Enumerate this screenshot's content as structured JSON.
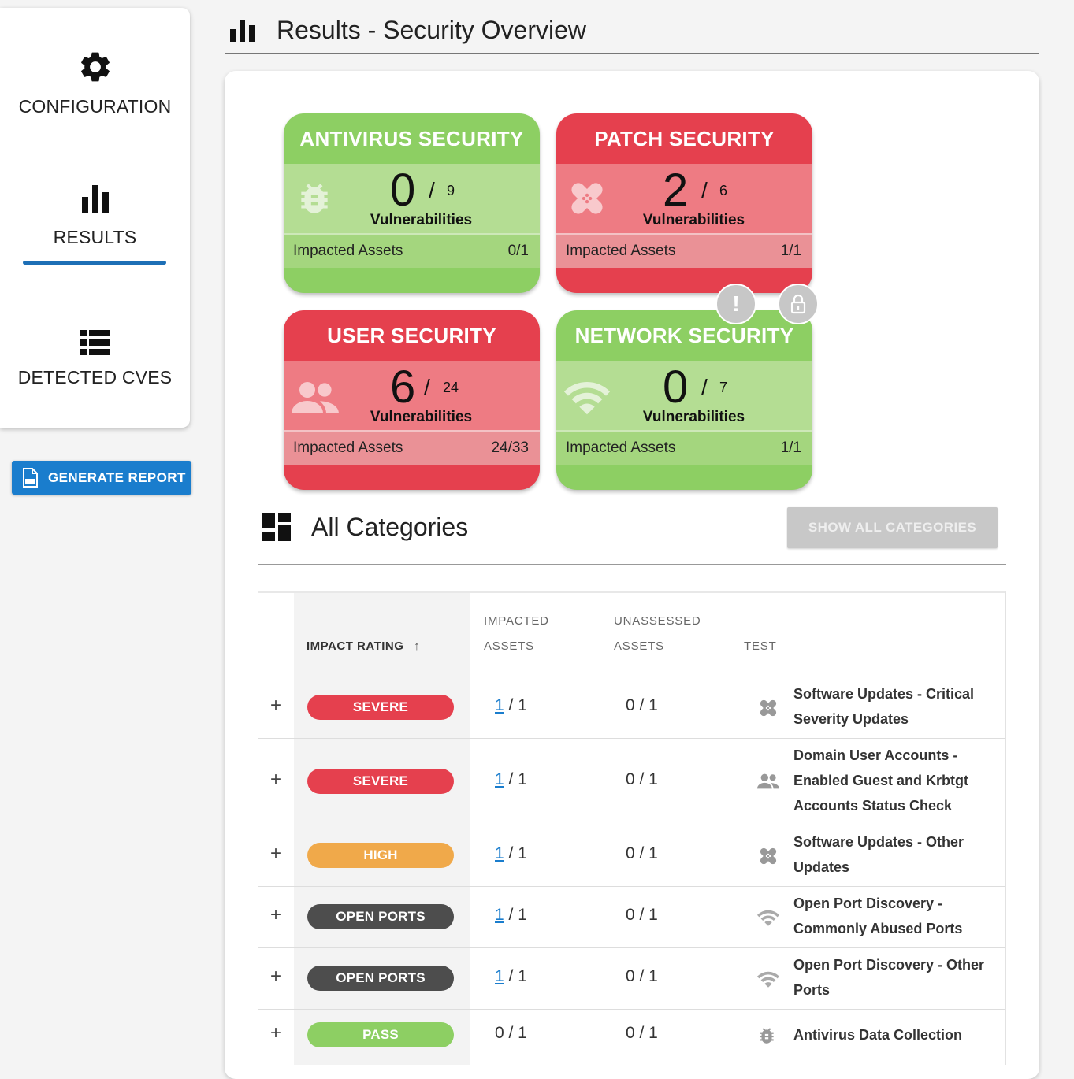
{
  "nav": {
    "configuration": "CONFIGURATION",
    "results": "RESULTS",
    "detected_cves": "DETECTED CVES"
  },
  "generate_report": "GENERATE REPORT",
  "header": {
    "title": "Results - Security Overview"
  },
  "tiles": [
    {
      "title": "ANTIVIRUS SECURITY",
      "status": "green",
      "count": "0",
      "slash": "/",
      "total": "9",
      "vuln_label": "Vulnerabilities",
      "assets_label": "Impacted Assets",
      "assets_value": "0/1",
      "icon": "bug-icon"
    },
    {
      "title": "PATCH SECURITY",
      "status": "red",
      "count": "2",
      "slash": "/",
      "total": "6",
      "vuln_label": "Vulnerabilities",
      "assets_label": "Impacted Assets",
      "assets_value": "1/1",
      "icon": "bandage-icon"
    },
    {
      "title": "USER SECURITY",
      "status": "red",
      "count": "6",
      "slash": "/",
      "total": "24",
      "vuln_label": "Vulnerabilities",
      "assets_label": "Impacted Assets",
      "assets_value": "24/33",
      "icon": "users-icon"
    },
    {
      "title": "NETWORK SECURITY",
      "status": "green",
      "count": "0",
      "slash": "/",
      "total": "7",
      "vuln_label": "Vulnerabilities",
      "assets_label": "Impacted Assets",
      "assets_value": "1/1",
      "icon": "wifi-icon"
    }
  ],
  "floating_buttons": {
    "alert": "!",
    "lock": "lock-icon"
  },
  "categories": {
    "title": "All Categories",
    "show_all": "SHOW ALL CATEGORIES",
    "columns": {
      "impact": "IMPACT RATING",
      "sort_arrow": "↑",
      "impacted_1": "IMPACTED",
      "impacted_2": "ASSETS",
      "unassessed_1": "UNASSESSED",
      "unassessed_2": "ASSETS",
      "test": "TEST"
    },
    "rows": [
      {
        "expand": "+",
        "rating": "SEVERE",
        "impacted_link": "1",
        "impacted_rest": " / 1",
        "unassessed": "0 / 1",
        "icon": "bandage-icon",
        "test_lines": [
          "Software Updates - Critical",
          "Severity Updates"
        ]
      },
      {
        "expand": "+",
        "rating": "SEVERE",
        "impacted_link": "1",
        "impacted_rest": " / 1",
        "unassessed": "0 / 1",
        "icon": "users-icon",
        "test_lines": [
          "Domain User Accounts -",
          "Enabled Guest and Krbtgt",
          "Accounts Status Check"
        ]
      },
      {
        "expand": "+",
        "rating": "HIGH",
        "impacted_link": "1",
        "impacted_rest": " / 1",
        "unassessed": "0 / 1",
        "icon": "bandage-icon",
        "test_lines": [
          "Software Updates - Other",
          "Updates"
        ]
      },
      {
        "expand": "+",
        "rating": "OPEN PORTS",
        "impacted_link": "1",
        "impacted_rest": " / 1",
        "unassessed": "0 / 1",
        "icon": "wifi-icon",
        "test_lines": [
          "Open Port Discovery -",
          "Commonly Abused Ports"
        ]
      },
      {
        "expand": "+",
        "rating": "OPEN PORTS",
        "impacted_link": "1",
        "impacted_rest": " / 1",
        "unassessed": "0 / 1",
        "icon": "wifi-icon",
        "test_lines": [
          "Open Port Discovery - Other",
          "Ports"
        ]
      },
      {
        "expand": "+",
        "rating": "PASS",
        "impacted_link": "",
        "impacted_rest": "0 / 1",
        "unassessed": "0 / 1",
        "icon": "bug-icon",
        "test_lines": [
          "Antivirus Data Collection"
        ]
      }
    ]
  },
  "colors": {
    "accent": "#1a7dcd",
    "green_tile": "#8dcf63",
    "red_tile": "#e5404e",
    "severe": "#e5404e",
    "high": "#f0a94a",
    "open_ports": "#4d4d4d",
    "pass": "#8dcf63"
  }
}
